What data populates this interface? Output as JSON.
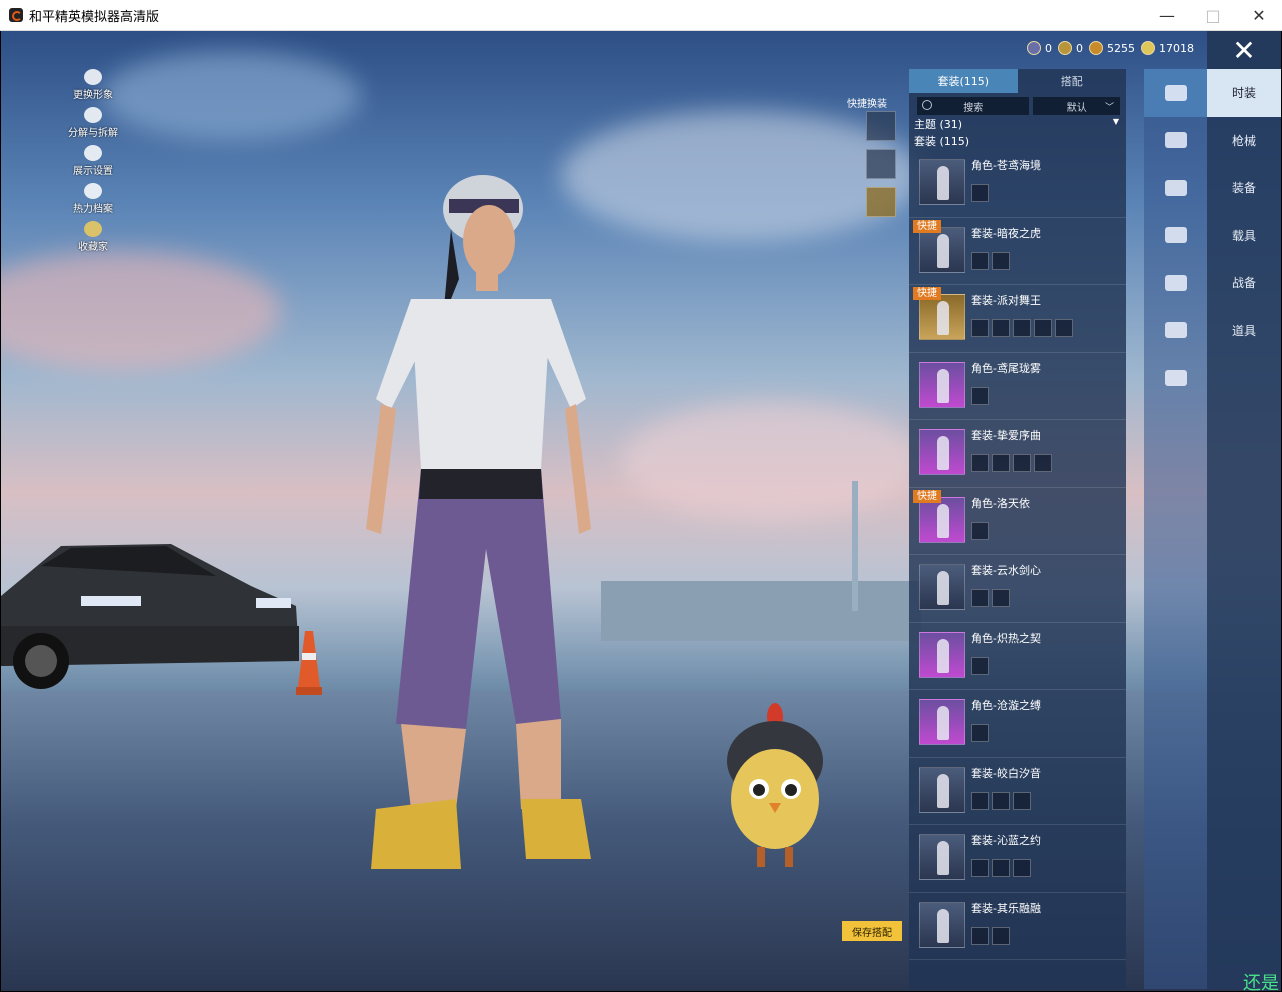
{
  "window": {
    "title": "和平精英模拟器高清版",
    "minimize": "—",
    "maximize": "□",
    "close": "✕"
  },
  "side_menu": [
    {
      "label": "更换形象",
      "icon": "person-icon"
    },
    {
      "label": "分解与拆解",
      "icon": "puzzle-icon"
    },
    {
      "label": "展示设置",
      "icon": "eye-icon"
    },
    {
      "label": "热力档案",
      "icon": "flame-icon"
    },
    {
      "label": "收藏家",
      "icon": "collector-badge-icon"
    }
  ],
  "currency": [
    {
      "value": "0",
      "icon": "coin-icon"
    },
    {
      "value": "0",
      "icon": "coin-icon"
    },
    {
      "value": "5255",
      "icon": "coin-icon"
    },
    {
      "value": "17018",
      "icon": "coin-icon"
    }
  ],
  "close_label": "✕",
  "quick_swap": {
    "label": "快捷换装"
  },
  "panel": {
    "tabs": [
      "套装(115)",
      "搭配"
    ],
    "search_placeholder": "搜索",
    "sort_value": "默认",
    "section_theme": "主题 (31)",
    "section_suits": "套装 (115)",
    "items": [
      {
        "name": "角色-苍鸢海境",
        "badge": "",
        "thumb": "blue",
        "parts": 1
      },
      {
        "name": "套装-暗夜之虎",
        "badge": "快捷",
        "thumb": "blue",
        "parts": 2
      },
      {
        "name": "套装-派对舞王",
        "badge": "快捷",
        "thumb": "gold",
        "parts": 5
      },
      {
        "name": "角色-鸢尾珑雾",
        "badge": "",
        "thumb": "purple",
        "parts": 1
      },
      {
        "name": "套装-挚爱序曲",
        "badge": "",
        "thumb": "purple",
        "parts": 4
      },
      {
        "name": "角色-洛天依",
        "badge": "快捷",
        "thumb": "purple",
        "parts": 1
      },
      {
        "name": "套装-云水剑心",
        "badge": "",
        "thumb": "blue",
        "parts": 2
      },
      {
        "name": "角色-炽热之契",
        "badge": "",
        "thumb": "purple",
        "parts": 1
      },
      {
        "name": "角色-沧漩之缚",
        "badge": "",
        "thumb": "purple",
        "parts": 1
      },
      {
        "name": "套装-皎白汐音",
        "badge": "",
        "thumb": "blue",
        "parts": 3
      },
      {
        "name": "套装-沁蓝之约",
        "badge": "",
        "thumb": "blue",
        "parts": 3
      },
      {
        "name": "套装-其乐融融",
        "badge": "",
        "thumb": "blue",
        "parts": 2
      }
    ]
  },
  "categories": [
    {
      "label": "时装",
      "icon": "outfit-icon"
    },
    {
      "label": "枪械",
      "icon": "gun-icon"
    },
    {
      "label": "装备",
      "icon": "goggles-icon"
    },
    {
      "label": "载具",
      "icon": "mask-icon"
    },
    {
      "label": "战备",
      "icon": "jacket-icon"
    },
    {
      "label": "道具",
      "icon": "backpack-icon"
    },
    {
      "label": "",
      "icon": "shoe-icon"
    }
  ],
  "save_button": "保存搭配",
  "corner_text": "还是"
}
